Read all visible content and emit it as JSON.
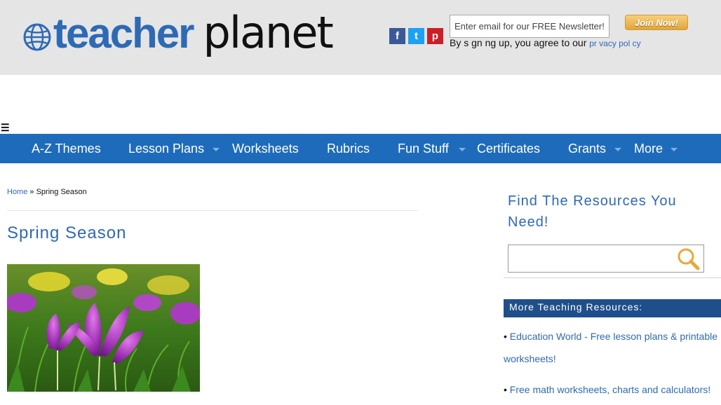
{
  "header": {
    "logo": {
      "word1": "teacher",
      "word2": "planet"
    },
    "social": [
      {
        "name": "facebook",
        "glyph": "f",
        "color": "#3b5998"
      },
      {
        "name": "twitter",
        "glyph": "t",
        "color": "#1da1f2"
      },
      {
        "name": "pinterest",
        "glyph": "p",
        "color": "#cb2027"
      }
    ],
    "newsletter": {
      "placeholder": "Enter email for our FREE Newsletter!",
      "join_label": "Join Now!",
      "agree_text": "By s gn ng up, you agree to our",
      "privacy_label": "pr vacy pol cy"
    }
  },
  "nav": {
    "menu_icon": "☰",
    "items": [
      {
        "label": "A-Z Themes",
        "has_submenu": false
      },
      {
        "label": "Lesson Plans",
        "has_submenu": true
      },
      {
        "label": "Worksheets",
        "has_submenu": false
      },
      {
        "label": "Rubrics",
        "has_submenu": false
      },
      {
        "label": "Fun Stuff",
        "has_submenu": true
      },
      {
        "label": "Certificates",
        "has_submenu": false
      },
      {
        "label": "Grants",
        "has_submenu": true
      },
      {
        "label": "More",
        "has_submenu": true
      }
    ]
  },
  "breadcrumb": {
    "home": "Home",
    "separator": "»",
    "current": "Spring Season"
  },
  "main": {
    "title": "Spring Season",
    "hero_image": "purple crocus flowers in grass"
  },
  "sidebar": {
    "find_title": "Find The Resources You Need!",
    "search_placeholder": "",
    "more_header": "More Teaching Resources:",
    "resources": [
      {
        "bullet": "•",
        "label": "Education World - Free lesson plans & printable worksheets!"
      },
      {
        "bullet": "•",
        "label": "Free math worksheets, charts and calculators!"
      }
    ]
  },
  "colors": {
    "brand_blue": "#2e6ab4",
    "nav_bg": "#1f6bbb",
    "header_bg": "#e5e5e5",
    "section_header": "#1f4f8a",
    "join_button": "#f0b24f"
  }
}
